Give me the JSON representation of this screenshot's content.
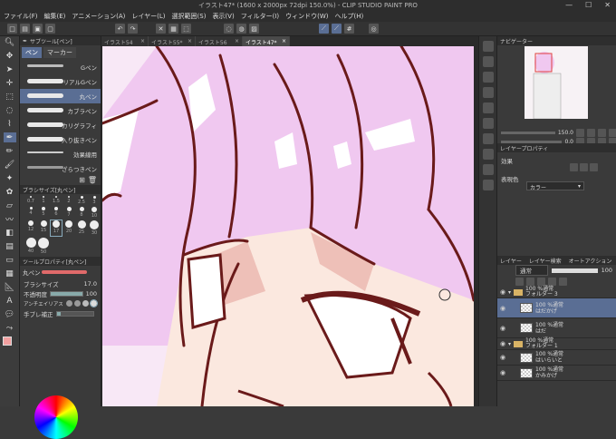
{
  "title": "イラスト47* (1600 x 2000px 72dpi 150.0%)  - CLIP STUDIO PAINT PRO",
  "menu": [
    "ファイル(F)",
    "編集(E)",
    "アニメーション(A)",
    "レイヤー(L)",
    "選択範囲(S)",
    "表示(V)",
    "フィルター(I)",
    "ウィンドウ(W)",
    "ヘルプ(H)"
  ],
  "tabs": [
    "イラスト54",
    "イラスト55*",
    "イラスト56",
    "イラスト47*"
  ],
  "subtool": {
    "header": "サブツール[ペン]",
    "tab_pen": "ペン",
    "tab_marker": "マーカー",
    "brushes": [
      "Gペン",
      "リアルGペン",
      "丸ペン",
      "カブラペン",
      "カリグラフィ",
      "入り抜きペン",
      "効果線用",
      "ざらつきペン"
    ],
    "selected_brush": "丸ペン"
  },
  "brush_size_panel": {
    "header": "ブラシサイズ[丸ペン]",
    "sizes": [
      "0.7",
      "1",
      "1.5",
      "2",
      "2.5",
      "3",
      "4",
      "5",
      "6",
      "7",
      "8",
      "10",
      "12",
      "15",
      "17",
      "20",
      "25",
      "30",
      "40",
      "50"
    ]
  },
  "tool_property": {
    "header": "ツールプロパティ[丸ペン]",
    "name": "丸ペン",
    "brush_size_label": "ブラシサイズ",
    "brush_size_value": "17.0",
    "brush_size_fraction": 0.35,
    "opacity_label": "不透明度",
    "opacity_value": "100",
    "opacity_fraction": 1.0,
    "antialias_label": "アンチエイリアス",
    "stabilize_label": "手ブレ補正"
  },
  "navigator": {
    "header": "ナビゲーター",
    "zoom": "150.0",
    "angle": "0.0"
  },
  "layer_property": {
    "header": "レイヤープロパティ",
    "effect_label": "効果",
    "expression_color_label": "表現色",
    "expression_color_value": "カラー"
  },
  "layers_panel": {
    "header_layer": "レイヤー",
    "header_search": "レイヤー検索",
    "header_auto": "オートアクション",
    "blend_mode": "通常",
    "opacity": "100",
    "rows": [
      {
        "mode": "100 %通常",
        "name": "フォルダー 3",
        "type": "folder"
      },
      {
        "mode": "100 %通常",
        "name": "はだかげ",
        "type": "layer",
        "selected": true
      },
      {
        "mode": "100 %通常",
        "name": "はだ",
        "type": "layer"
      },
      {
        "mode": "100 %通常",
        "name": "フォルダー 1",
        "type": "folder"
      },
      {
        "mode": "100 %通常",
        "name": "はいらいと",
        "type": "layer"
      },
      {
        "mode": "100 %通常",
        "name": "かみかげ",
        "type": "layer"
      }
    ]
  },
  "colors": {
    "hair": "#f0c8f0",
    "hair_light": "#f7e0f7",
    "skin": "#fbe8df",
    "skin_shadow": "#eec0b8",
    "line": "#6a1a1a"
  }
}
